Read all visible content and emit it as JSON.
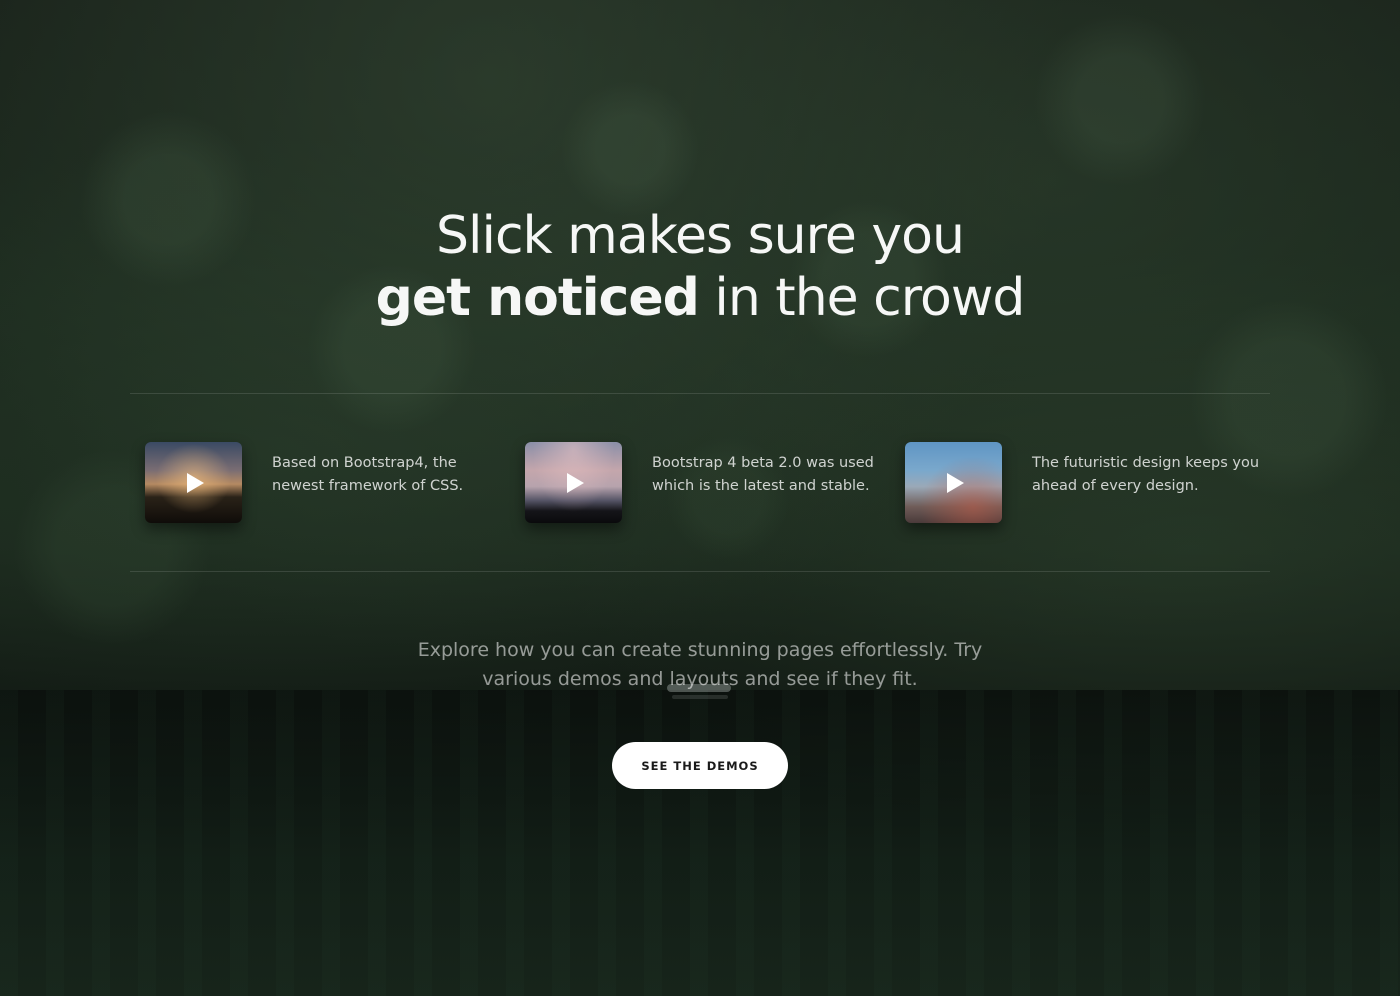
{
  "colors": {
    "overlay_dark_green": "#1a271c",
    "text": "#ffffff",
    "button_bg": "#ffffff",
    "button_text": "#1a1a1a"
  },
  "headline": {
    "line1": "Slick makes sure you",
    "line2_bold": "get noticed",
    "line2_rest": " in the crowd"
  },
  "features": [
    {
      "icon": "play-icon",
      "text": "Based on Bootstrap4, the newest framework of CSS."
    },
    {
      "icon": "play-icon",
      "text": "Bootstrap 4 beta 2.0 was used which is the latest and stable."
    },
    {
      "icon": "play-icon",
      "text": "The futuristic design keeps you ahead of every design."
    }
  ],
  "explore_text": "Explore how you can create stunning pages effortlessly. Try various demos and layouts and see if they fit.",
  "cta": {
    "label": "SEE THE DEMOS"
  }
}
